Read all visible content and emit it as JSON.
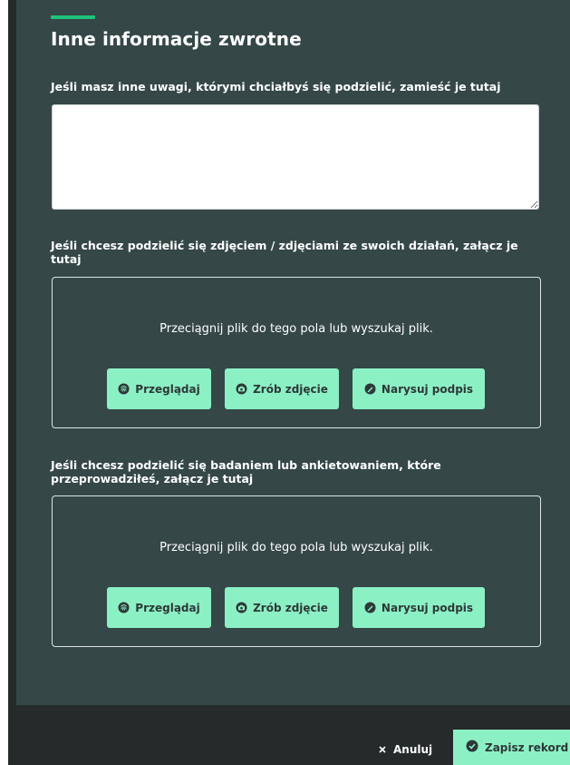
{
  "section": {
    "title": "Inne informacje zwrotne"
  },
  "feedback": {
    "question": "Jeśli masz inne uwagi, którymi chciałbyś się podzielić, zamieść je tutaj",
    "value": ""
  },
  "photos": {
    "question": "Jeśli chcesz podzielić się zdjęciem / zdjęciami ze swoich działań, załącz je tutaj",
    "dropzone_text": "Przeciągnij plik do tego pola lub wyszukaj plik.",
    "browse_label": "Przeglądaj",
    "photo_label": "Zrób zdjęcie",
    "sign_label": "Narysuj podpis"
  },
  "survey": {
    "question": "Jeśli chcesz podzielić się badaniem lub ankietowaniem, które przeprowadziłeś, załącz je tutaj",
    "dropzone_text": "Przeciągnij plik do tego pola lub wyszukaj plik.",
    "browse_label": "Przeglądaj",
    "photo_label": "Zrób zdjęcie",
    "sign_label": "Narysuj podpis"
  },
  "footer": {
    "cancel_label": "Anuluj",
    "save_label": "Zapisz rekord"
  },
  "colors": {
    "panel": "#354747",
    "frame": "#252a2a",
    "accent": "#1ec27a",
    "button": "#8cf0c5"
  },
  "icons": {
    "browse": "fingerprint-icon",
    "photo": "camera-icon",
    "sign": "pen-icon",
    "cancel": "close-icon",
    "save": "check-circle-icon"
  }
}
